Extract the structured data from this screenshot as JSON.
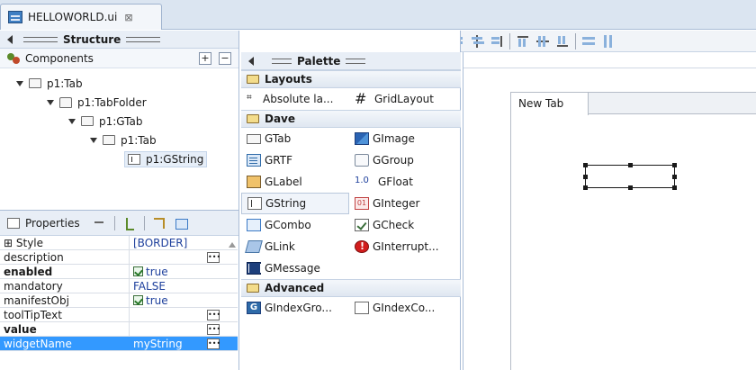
{
  "editor": {
    "tab_title": "HELLOWORLD.ui",
    "close_symbol": "⊠"
  },
  "structure": {
    "title": "Structure",
    "components_label": "Components",
    "tree": [
      {
        "label": "p1:Tab"
      },
      {
        "label": "p1:TabFolder"
      },
      {
        "label": "p1:GTab"
      },
      {
        "label": "p1:Tab"
      },
      {
        "label": "p1:GString"
      }
    ]
  },
  "properties": {
    "title": "Properties",
    "rows": [
      {
        "name": "⊞ Style",
        "value": "[BORDER]"
      },
      {
        "name": "description",
        "value": ""
      },
      {
        "name": "enabled",
        "value": "true"
      },
      {
        "name": "mandatory",
        "value": "FALSE"
      },
      {
        "name": "manifestObj",
        "value": "true"
      },
      {
        "name": "toolTipText",
        "value": ""
      },
      {
        "name": "value",
        "value": ""
      },
      {
        "name": "widgetName",
        "value": "myString"
      }
    ]
  },
  "palette": {
    "title": "Palette",
    "drawers": {
      "layouts": "Layouts",
      "dave": "Dave",
      "advanced": "Advanced"
    },
    "layouts": [
      "Absolute la...",
      "GridLayout"
    ],
    "dave": [
      [
        "GTab",
        "GImage"
      ],
      [
        "GRTF",
        "GGroup"
      ],
      [
        "GLabel",
        "GFloat"
      ],
      [
        "GString",
        "GInteger"
      ],
      [
        "GCombo",
        "GCheck"
      ],
      [
        "GLink",
        "GInterrupt..."
      ],
      [
        "GMessage",
        ""
      ]
    ],
    "advanced": [
      "GIndexGro...",
      "GIndexCo..."
    ]
  },
  "canvas": {
    "tab_label": "New Tab"
  },
  "icons": {
    "gfloat_text": "1.0",
    "ginteger_text": "01",
    "gindex_text": "G",
    "abs_text": "⌗",
    "grid_text": "#"
  }
}
